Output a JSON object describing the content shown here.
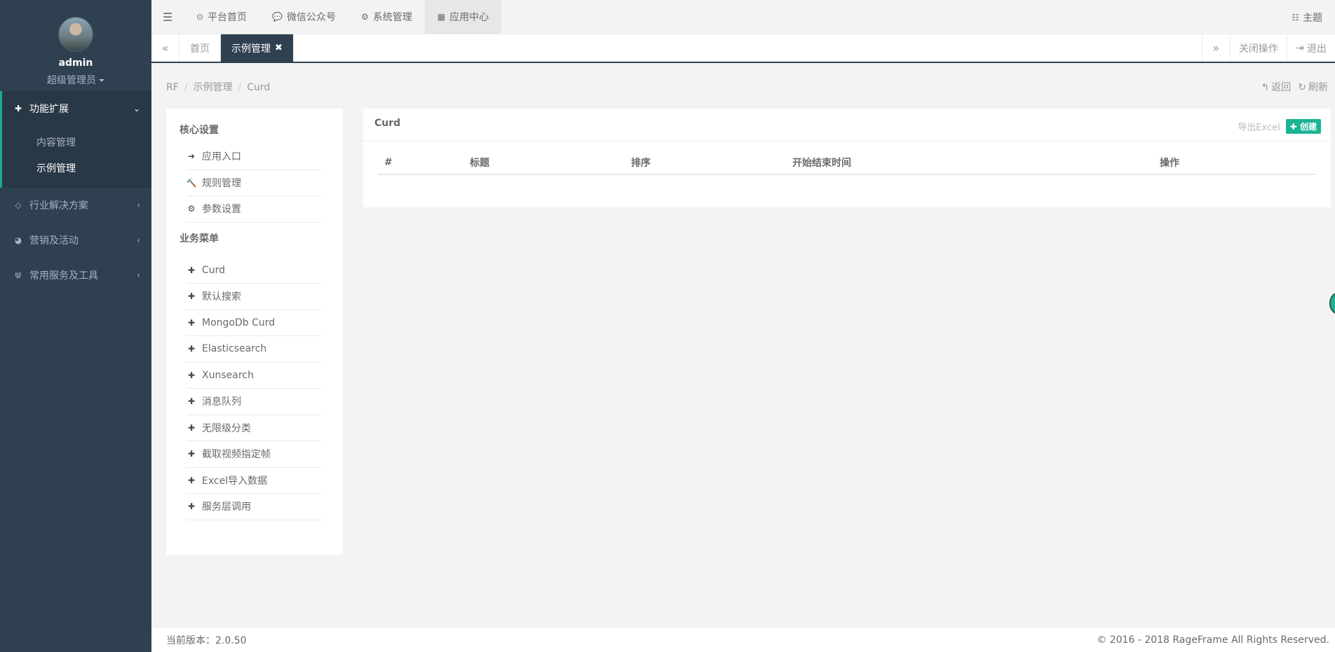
{
  "profile": {
    "name": "admin",
    "role": "超级管理员"
  },
  "sidebar": {
    "groups": [
      {
        "label": "功能扩展",
        "icon": "puzzle-icon",
        "sub": [
          "内容管理",
          "示例管理"
        ]
      },
      {
        "label": "行业解决方案",
        "icon": "diamond-icon"
      },
      {
        "label": "营销及活动",
        "icon": "dashboard-icon"
      },
      {
        "label": "常用服务及工具",
        "icon": "magnet-icon"
      }
    ]
  },
  "topbar": {
    "items": [
      "平台首页",
      "微信公众号",
      "系统管理",
      "应用中心"
    ],
    "theme": "主题"
  },
  "tabs": {
    "items": [
      "首页",
      "示例管理"
    ],
    "close_ops": "关闭操作",
    "logout": "退出"
  },
  "breadcrumb": [
    "RF",
    "示例管理",
    "Curd"
  ],
  "crumb_actions": {
    "back": "返回",
    "refresh": "刷新"
  },
  "menu": {
    "core_title": "核心设置",
    "core_items": [
      "应用入口",
      "规则管理",
      "参数设置"
    ],
    "biz_title": "业务菜单",
    "biz_items": [
      "Curd",
      "默认搜索",
      "MongoDb Curd",
      "Elasticsearch",
      "Xunsearch",
      "消息队列",
      "无限级分类",
      "截取视频指定帧",
      "Excel导入数据",
      "服务层调用"
    ]
  },
  "panel": {
    "title": "Curd",
    "export": "导出Excel",
    "create": "创建",
    "columns": [
      "#",
      "标题",
      "排序",
      "开始结束时间",
      "操作"
    ]
  },
  "footer": {
    "version": "当前版本：2.0.50",
    "copyright": "© 2016 - 2018 RageFrame All Rights Reserved."
  }
}
